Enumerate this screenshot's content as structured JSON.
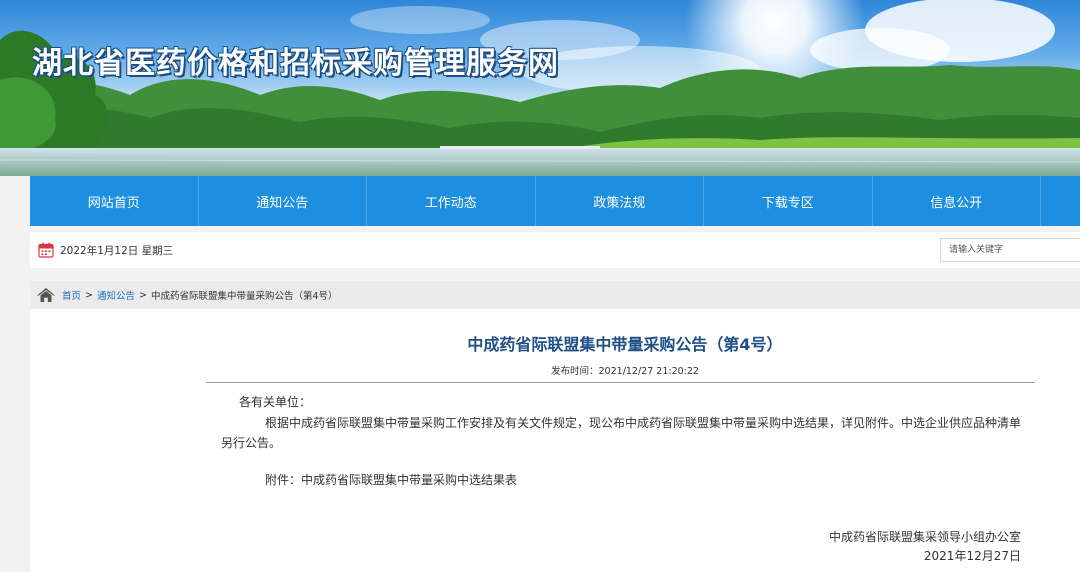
{
  "site": {
    "title": "湖北省医药价格和招标采购管理服务网"
  },
  "nav": {
    "items": [
      {
        "label": "网站首页"
      },
      {
        "label": "通知公告"
      },
      {
        "label": "工作动态"
      },
      {
        "label": "政策法规"
      },
      {
        "label": "下载专区"
      },
      {
        "label": "信息公开"
      }
    ]
  },
  "infobar": {
    "date": "2022年1月12日 星期三",
    "search_placeholder": "请输入关键字"
  },
  "breadcrumb": {
    "items": [
      "首页",
      "通知公告",
      "中成药省际联盟集中带量采购公告（第4号）"
    ],
    "separator": ">"
  },
  "article": {
    "title": "中成药省际联盟集中带量采购公告（第4号）",
    "publish_time": "发布时间：2021/12/27 21:20:22",
    "salutation": "各有关单位：",
    "body": "根据中成药省际联盟集中带量采购工作安排及有关文件规定，现公布中成药省际联盟集中带量采购中选结果，详见附件。中选企业供应品种清单另行公告。",
    "attachment_label": "附件：",
    "attachment_name": "中成药省际联盟集中带量采购中选结果表",
    "signature_org": "中成药省际联盟集采领导小组办公室",
    "signature_date": "2021年12月27日"
  },
  "colors": {
    "nav_bg": "#1d8fe0",
    "title_color": "#1f4f86",
    "link_color": "#1d6fc0",
    "calendar_icon": "#d9363e"
  },
  "icons": [
    "calendar-icon",
    "home-icon"
  ]
}
